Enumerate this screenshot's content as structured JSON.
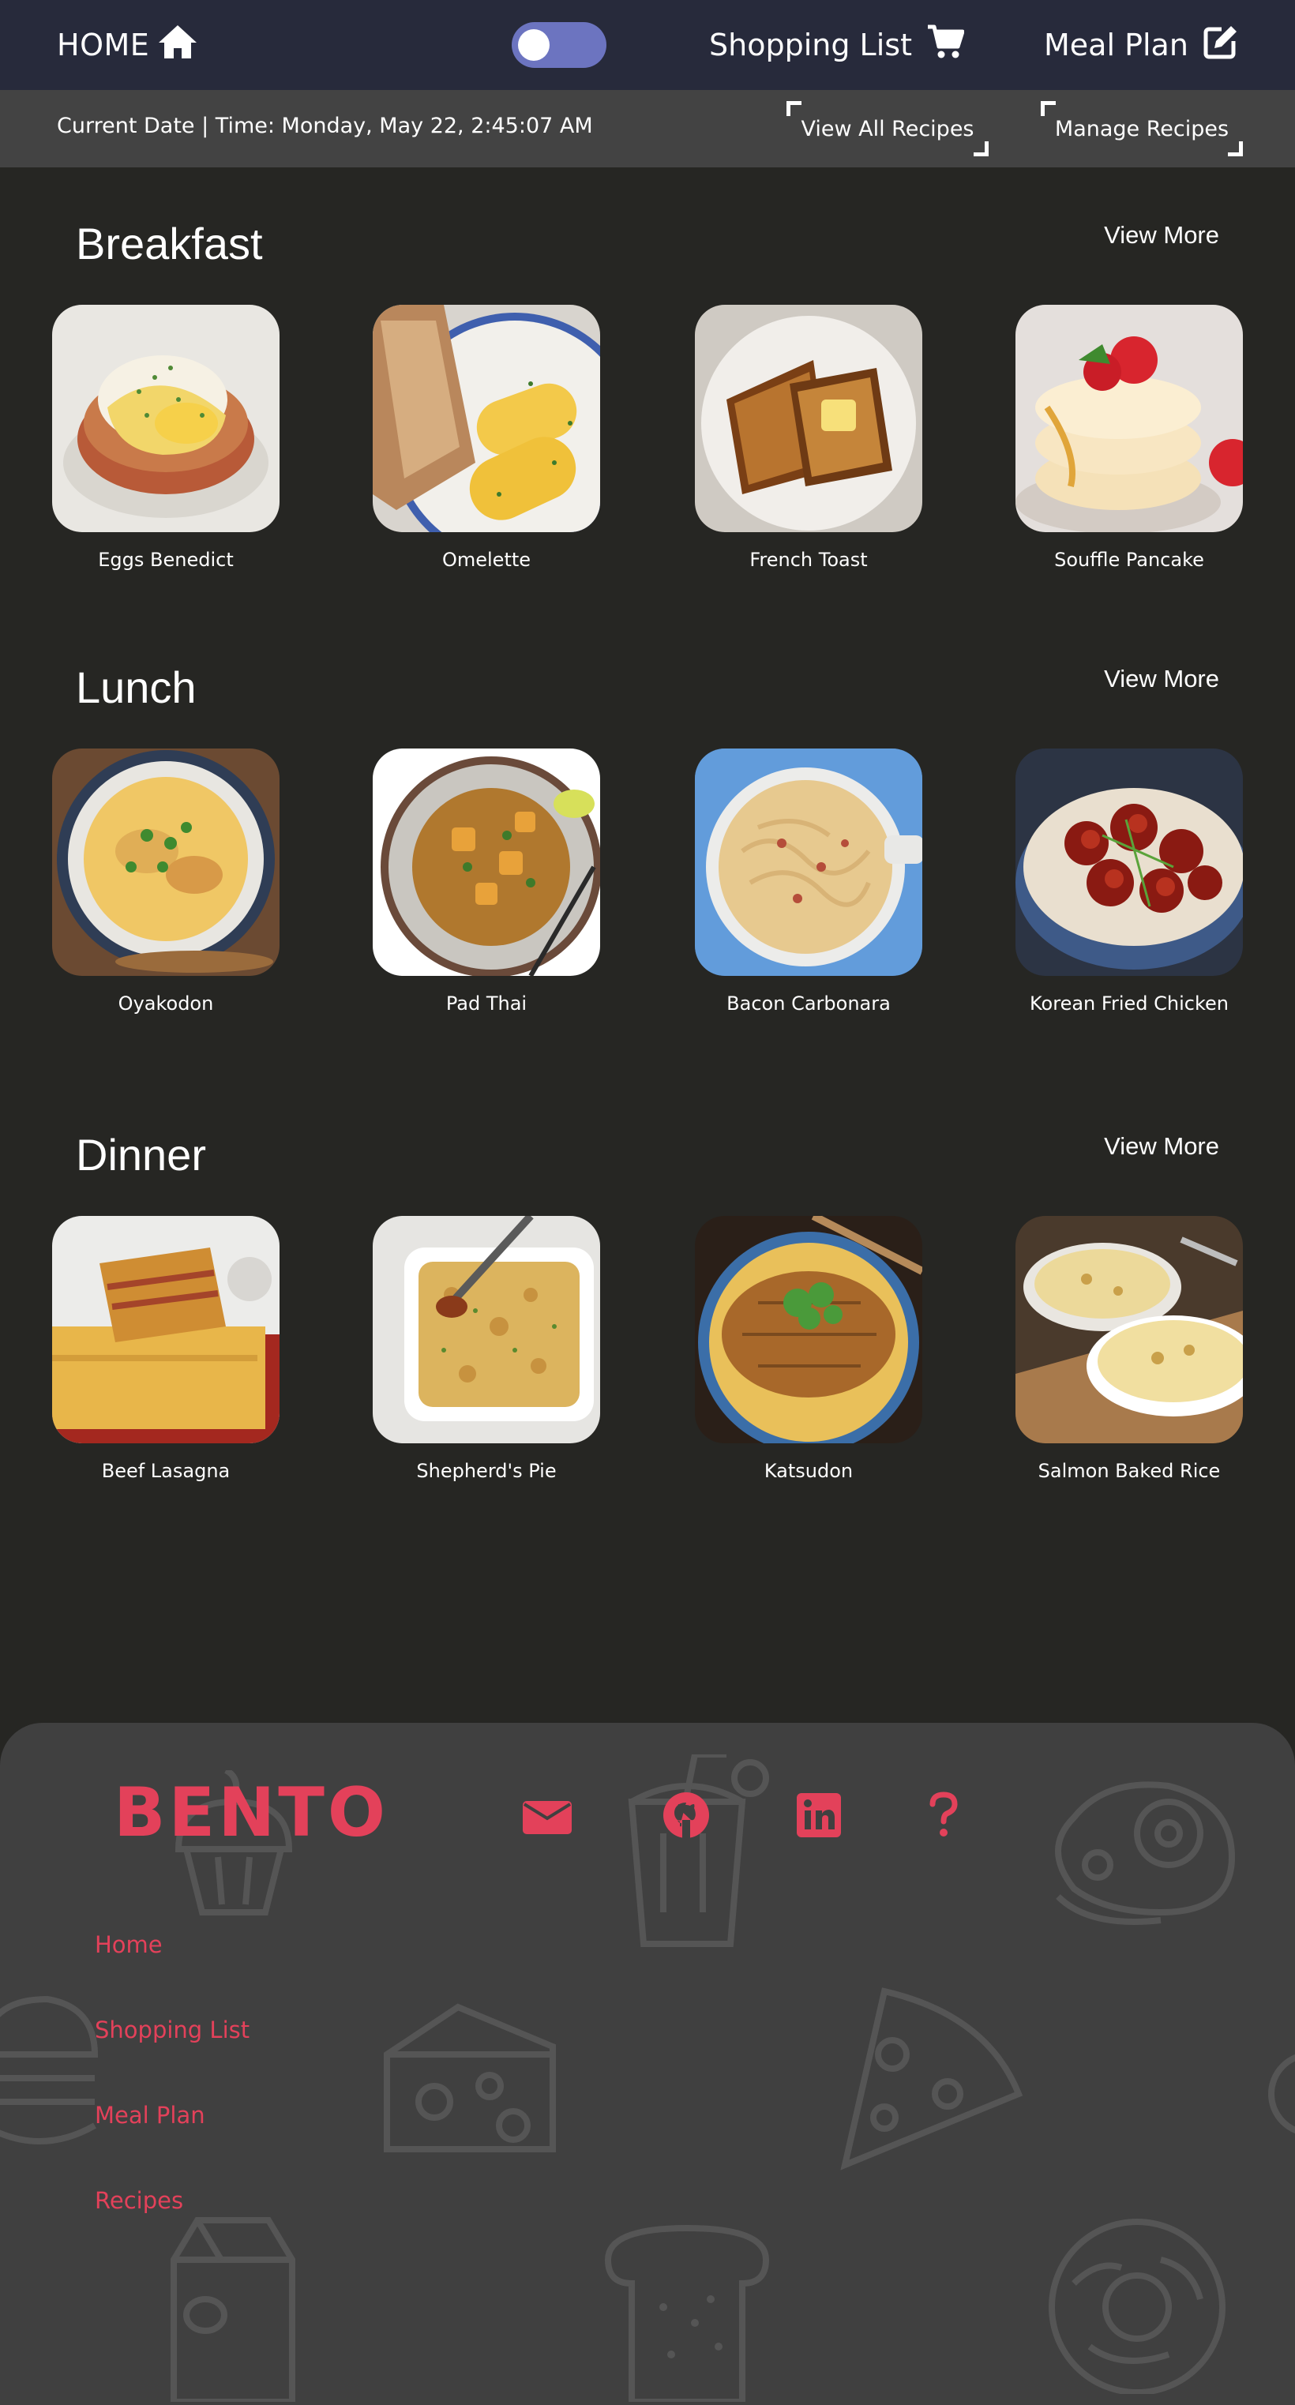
{
  "nav": {
    "home_label": "HOME",
    "shopping_label": "Shopping List",
    "meal_label": "Meal Plan",
    "theme_toggle": "off"
  },
  "subbar": {
    "current_date": "Current Date | Time: Monday, May 22, 2:45:07 AM",
    "view_all": "View All Recipes",
    "manage": "Manage Recipes"
  },
  "sections": [
    {
      "title": "Breakfast",
      "view_more": "View More",
      "items": [
        "Eggs Benedict",
        "Omelette",
        "French Toast",
        "Souffle Pancake"
      ]
    },
    {
      "title": "Lunch",
      "view_more": "View More",
      "items": [
        "Oyakodon",
        "Pad Thai",
        "Bacon Carbonara",
        "Korean Fried Chicken"
      ]
    },
    {
      "title": "Dinner",
      "view_more": "View More",
      "items": [
        "Beef Lasagna",
        "Shepherd's Pie",
        "Katsudon",
        "Salmon Baked Rice"
      ]
    }
  ],
  "footer": {
    "brand": "BENTO",
    "links": [
      "Home",
      "Shopping List",
      "Meal Plan",
      "Recipes"
    ],
    "social_icons": [
      "envelope-icon",
      "github-icon",
      "linkedin-icon",
      "question-icon"
    ]
  },
  "colors": {
    "nav_bg": "#272a3b",
    "subbar_bg": "#434343",
    "page_bg": "#262623",
    "footer_bg": "#404040",
    "accent": "#e3415a",
    "toggle": "#6c74c0"
  }
}
